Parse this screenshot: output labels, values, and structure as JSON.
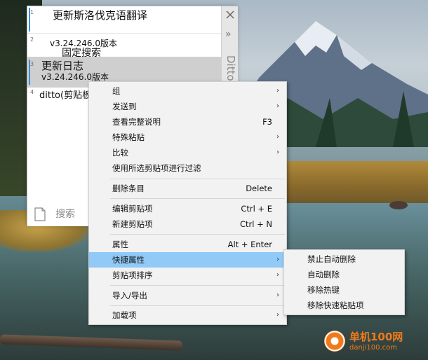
{
  "clip_window": {
    "items": [
      {
        "num": "1",
        "line1": "更新斯洛伐克语翻译",
        "line2": ""
      },
      {
        "num": "2",
        "line1": "v3.24.246.0版本",
        "line2": "固定搜索"
      },
      {
        "num": "3",
        "line1": "更新日志",
        "line2": "v3.24.246.0版本"
      },
      {
        "num": "4",
        "line1": "ditto(剪贴板",
        "line2": ""
      }
    ],
    "sidebar_title": "Ditto",
    "sidebar_chevron": "»",
    "search_placeholder": "搜索"
  },
  "context_menu": {
    "items": [
      {
        "label": "组",
        "shortcut": "",
        "arrow": "›"
      },
      {
        "label": "发送到",
        "shortcut": "",
        "arrow": "›"
      },
      {
        "label": "查看完整说明",
        "shortcut": "F3",
        "arrow": ""
      },
      {
        "label": "特殊粘贴",
        "shortcut": "",
        "arrow": "›"
      },
      {
        "label": "比较",
        "shortcut": "",
        "arrow": "›"
      },
      {
        "label": "使用所选剪贴项进行过滤",
        "shortcut": "",
        "arrow": ""
      },
      {
        "label": "删除条目",
        "shortcut": "Delete",
        "arrow": ""
      },
      {
        "label": "编辑剪贴项",
        "shortcut": "Ctrl + E",
        "arrow": ""
      },
      {
        "label": "新建剪贴项",
        "shortcut": "Ctrl + N",
        "arrow": ""
      },
      {
        "label": "属性",
        "shortcut": "Alt + Enter",
        "arrow": ""
      },
      {
        "label": "快捷属性",
        "shortcut": "",
        "arrow": "›"
      },
      {
        "label": "剪贴项排序",
        "shortcut": "",
        "arrow": "›"
      },
      {
        "label": "导入/导出",
        "shortcut": "",
        "arrow": "›"
      },
      {
        "label": "加载项",
        "shortcut": "",
        "arrow": "›"
      }
    ]
  },
  "sub_menu": {
    "items": [
      {
        "label": "禁止自动删除"
      },
      {
        "label": "自动删除"
      },
      {
        "label": "移除热键"
      },
      {
        "label": "移除快速粘贴项"
      }
    ]
  },
  "watermark": {
    "title": "单机100网",
    "url": "danji100.com"
  },
  "colors": {
    "highlight": "#91c9f7",
    "accent_bar": "#3d8fd6",
    "watermark": "#f07a1a"
  }
}
